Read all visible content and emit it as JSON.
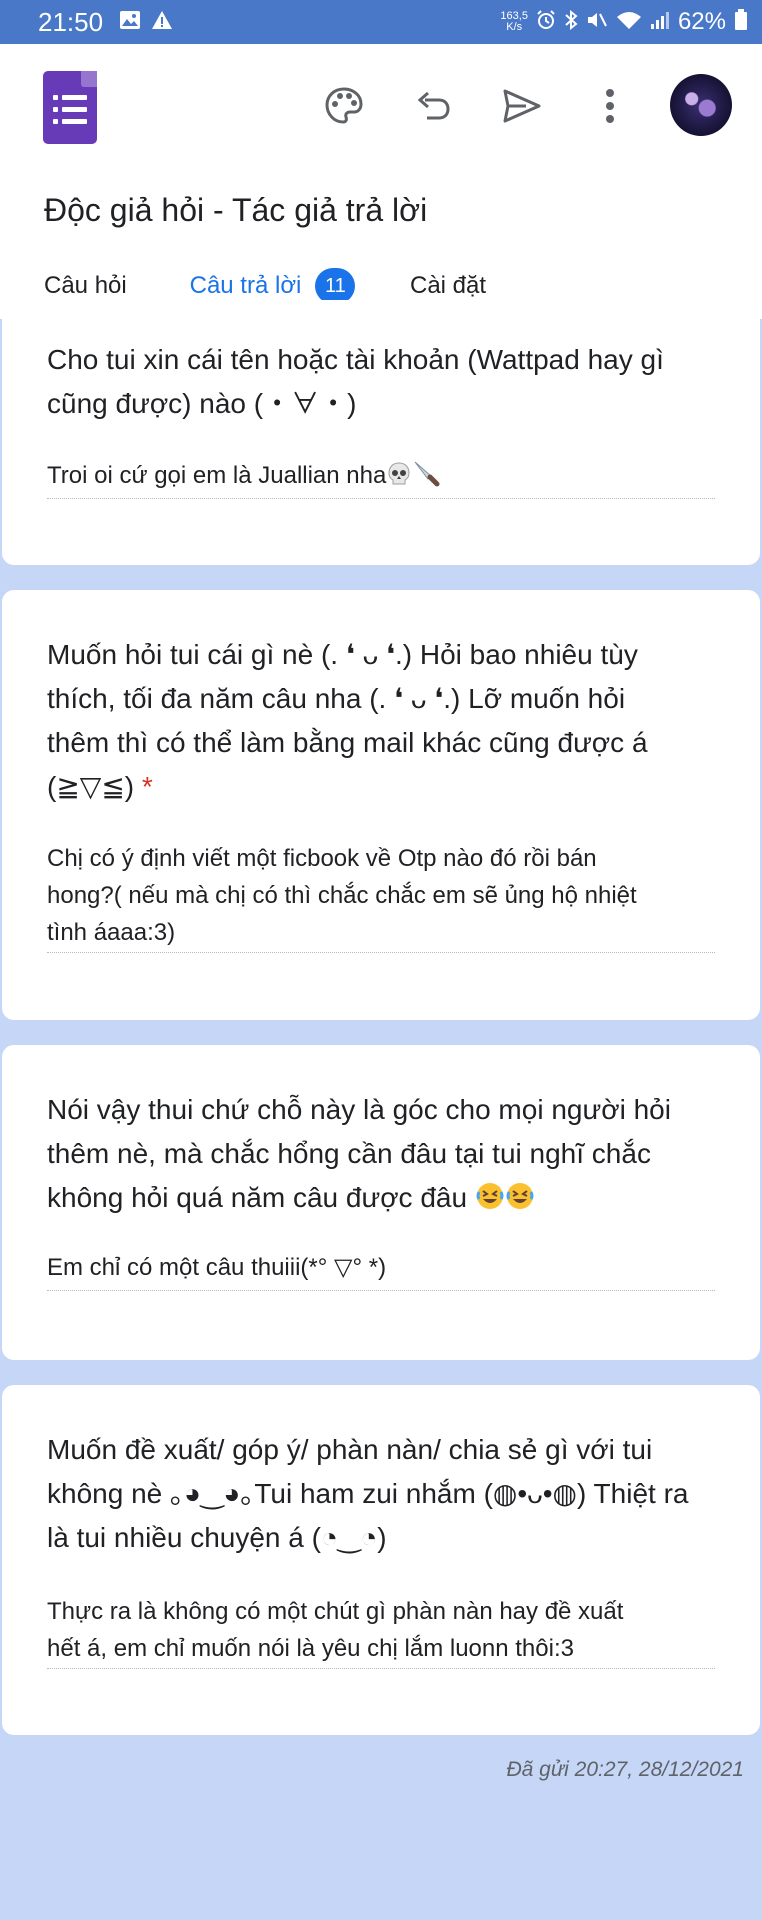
{
  "status_bar": {
    "time": "21:50",
    "net_speed_value": "163,5",
    "net_speed_unit": "K/s",
    "battery": "62%",
    "icons": [
      "gallery-icon",
      "alert-icon",
      "alarm-icon",
      "bluetooth-icon",
      "mute-icon",
      "wifi-icon",
      "signal-icon",
      "battery-icon"
    ]
  },
  "header": {
    "form_title": "Độc giả hỏi - Tác giả trả lời",
    "toolbar_icons": [
      "palette-icon",
      "undo-icon",
      "send-icon",
      "more-vert-icon"
    ]
  },
  "tabs": [
    {
      "label": "Câu hỏi"
    },
    {
      "label": "Câu trả lời",
      "badge": "11"
    },
    {
      "label": "Cài đặt"
    }
  ],
  "cards": [
    {
      "question_lines": [
        "Cho tui xin cái tên hoặc tài khoản (Wattpad hay gì",
        "cũng được) nào (・∀・)"
      ],
      "answer_lines": [
        "Troi oi cứ gọi em là Juallian nha"
      ],
      "answer_emojis": [
        "skull-emoji",
        "knife-emoji"
      ]
    },
    {
      "question_lines": [
        "Muốn hỏi tui cái gì nè (. ❛ ᴗ ❛.) Hỏi bao nhiêu tùy",
        "thích, tối đa năm câu nha (. ❛ ᴗ ❛.) Lỡ muốn hỏi",
        "thêm thì có thể làm bằng mail khác cũng được á",
        "(≧▽≦)"
      ],
      "required_mark": "*",
      "answer_lines": [
        "Chị có ý định viết một ficbook về Otp nào đó rồi bán",
        "hong?( nếu mà chị có thì chắc chắc em sẽ ủng hộ nhiệt",
        "tình áaaa:3)"
      ]
    },
    {
      "question_lines": [
        "Nói vậy thui chứ chỗ này là góc cho mọi người hỏi",
        "thêm nè, mà chắc hổng cần đâu tại tui nghĩ chắc",
        "không hỏi quá năm câu được đâu"
      ],
      "question_emojis": [
        "rofl-emoji",
        "rofl-emoji"
      ],
      "answer_lines": [
        "Em chỉ có một câu thuiii(*° ▽° *)"
      ]
    },
    {
      "question_lines": [
        "Muốn đề xuất/ góp ý/ phàn nàn/ chia sẻ gì với tui",
        "không nè ｡◕‿◕｡Tui ham zui nhắm (◍•ᴗ•◍) Thiệt ra",
        "là tui nhiều chuyện á (◔‿◔)"
      ],
      "answer_lines": [
        "Thực ra là không có một chút gì phàn nàn hay đề xuất",
        "hết á, em chỉ muốn nói là yêu chị lắm luonn thôi:3"
      ]
    }
  ],
  "footer": {
    "submitted": "Đã gửi 20:27, 28/12/2021"
  },
  "colors": {
    "status_bar": "#4a78c9",
    "accent": "#1a73e8",
    "forms_purple": "#673ab7",
    "page_background": "#c5d6f7",
    "required": "#d93025"
  }
}
